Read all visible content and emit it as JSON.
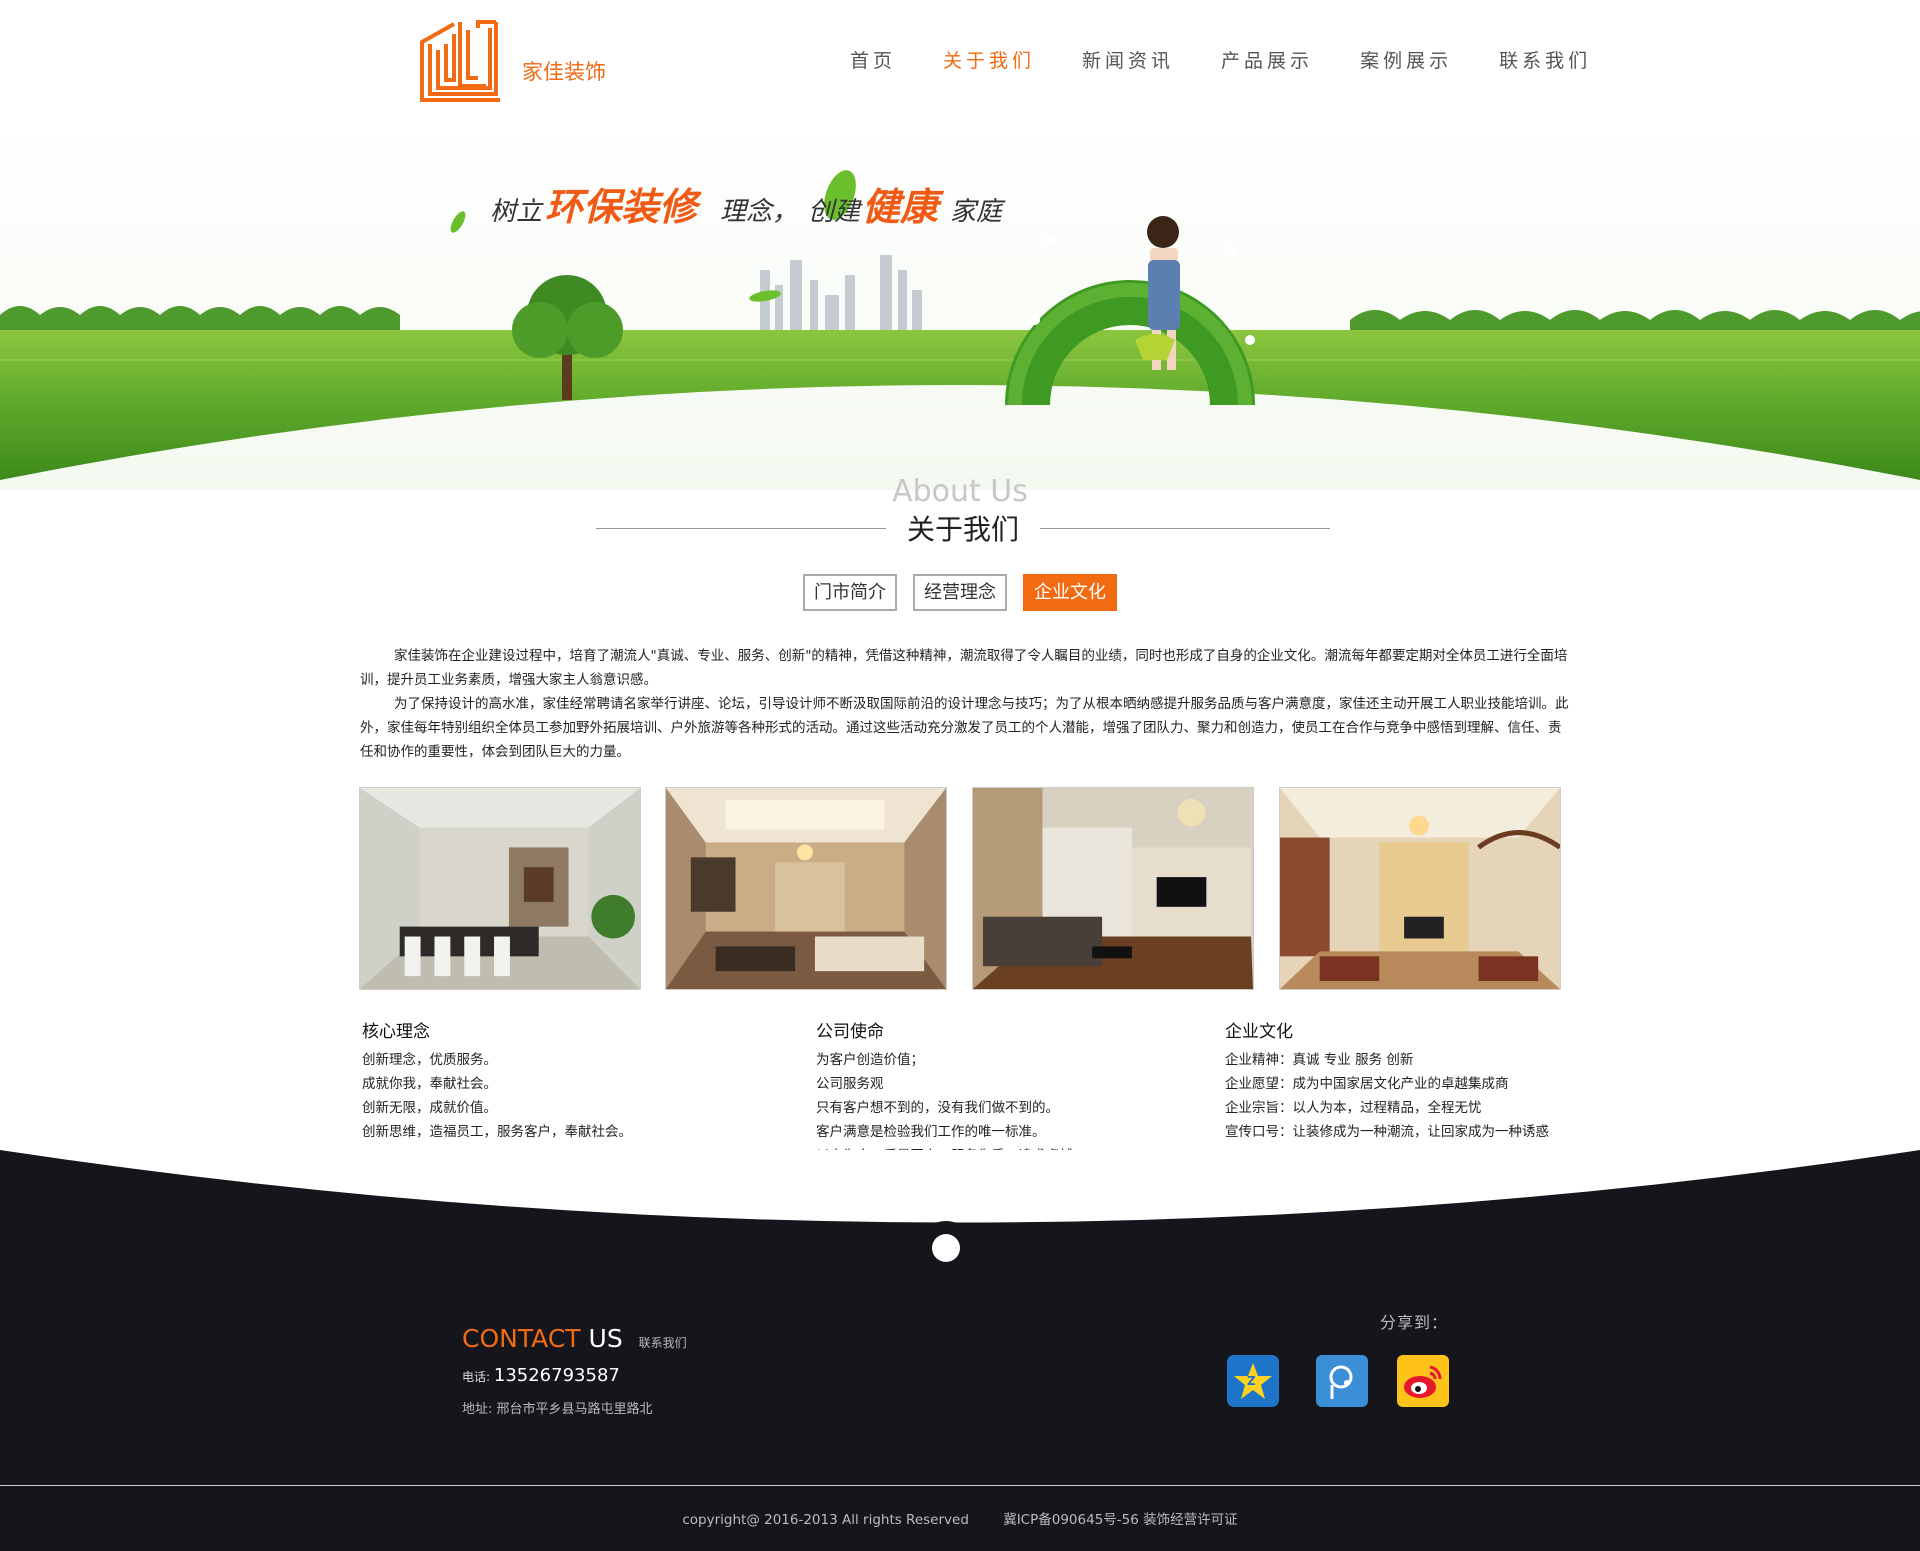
{
  "brand": {
    "name": "家佳装饰",
    "accent": "#f26a12",
    "dark": "#15161c"
  },
  "nav": [
    {
      "label": "首页",
      "active": false
    },
    {
      "label": "关于我们",
      "active": true
    },
    {
      "label": "新闻资讯",
      "active": false
    },
    {
      "label": "产品展示",
      "active": false
    },
    {
      "label": "案例展示",
      "active": false
    },
    {
      "label": "联系我们",
      "active": false
    }
  ],
  "banner": {
    "slogan_parts": [
      "树立",
      "环保装修",
      "理念，",
      "创建",
      "健康",
      "家庭"
    ]
  },
  "about": {
    "title_en": "About Us",
    "title_cn": "关于我们",
    "tabs": [
      {
        "label": "门市简介",
        "active": false
      },
      {
        "label": "经营理念",
        "active": false
      },
      {
        "label": "企业文化",
        "active": true
      }
    ],
    "paragraphs": [
      "家佳装饰在企业建设过程中，培育了潮流人\"真诚、专业、服务、创新\"的精神，凭借这种精神，潮流取得了令人瞩目的业绩，同时也形成了自身的企业文化。潮流每年都要定期对全体员工进行全面培训，提升员工业务素质，增强大家主人翁意识感。",
      "为了保持设计的高水准，家佳经常聘请名家举行讲座、论坛，引导设计师不断汲取国际前沿的设计理念与技巧；为了从根本晒纳感提升服务品质与客户满意度，家佳还主动开展工人职业技能培训。此外，家佳每年特别组织全体员工参加野外拓展培训、户外旅游等各种形式的活动。通过这些活动充分激发了员工的个人潜能，增强了团队力、聚力和创造力，使员工在合作与竞争中感悟到理解、信任、责任和协作的重要性，体会到团队巨大的力量。"
    ],
    "columns": [
      {
        "title": "核心理念",
        "items": [
          "创新理念，优质服务。",
          "成就你我，奉献社会。",
          "创新无限，成就价值。",
          "创新思维，造福员工，服务客户，奉献社会。"
        ]
      },
      {
        "title": "公司使命",
        "items": [
          "为客户创造价值；",
          "公司服务观",
          "只有客户想不到的，没有我们做不到的。",
          "客户满意是检验我们工作的唯一标准。",
          "以人为本、质量至上、服务为重、追求卓越。"
        ]
      },
      {
        "title": "企业文化",
        "items": [
          "企业精神：真诚 专业 服务 创新",
          "企业愿望：成为中国家居文化产业的卓越集成商",
          "企业宗旨：以人为本，过程精品，全程无忧",
          "宣传口号：让装修成为一种潮流，让回家成为一种诱惑"
        ]
      }
    ]
  },
  "contact": {
    "head_orange": "CONTACT",
    "head_white": "US",
    "head_small": "联系我们",
    "phone_label": "电话:",
    "phone": "13526793587",
    "address": "地址: 邢台市平乡县马路屯里路北",
    "share_label": "分享到："
  },
  "footer": {
    "copyright": "copyright@ 2016-2013   All rights Reserved",
    "icp": "冀ICP备090645号-56 装饰经营许可证"
  }
}
